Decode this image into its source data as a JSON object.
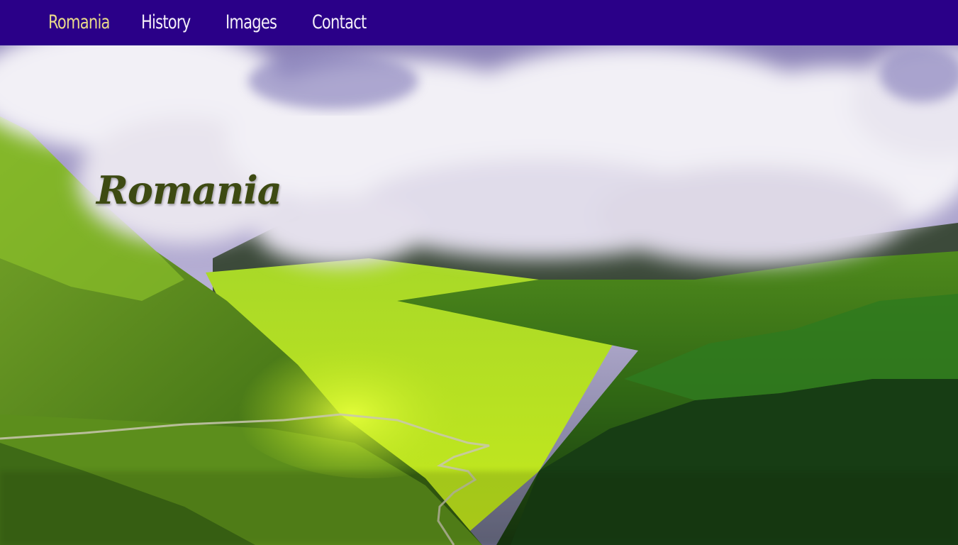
{
  "nav": {
    "items": [
      {
        "label": "Romania",
        "active": true
      },
      {
        "label": "History",
        "active": false
      },
      {
        "label": "Images",
        "active": false
      },
      {
        "label": "Contact",
        "active": false
      }
    ]
  },
  "hero": {
    "title": "Romania"
  },
  "colors": {
    "navbar_bg": "#2a0088",
    "nav_active": "#e8d98a",
    "nav_text": "#f3eef8",
    "title_color": "#3d4a12"
  }
}
